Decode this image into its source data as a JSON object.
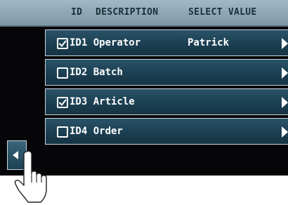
{
  "header": {
    "id_label": "ID",
    "description_label": "DESCRIPTION",
    "select_value_label": "SELECT VALUE"
  },
  "rows": [
    {
      "id": "ID1",
      "label": "ID1 Operator",
      "value": "Patrick",
      "checked": true
    },
    {
      "id": "ID2",
      "label": "ID2 Batch",
      "value": "",
      "checked": false
    },
    {
      "id": "ID3",
      "label": "ID3 Article",
      "value": "",
      "checked": true
    },
    {
      "id": "ID4",
      "label": "ID4 Order",
      "value": "",
      "checked": false
    }
  ],
  "icons": {
    "checkbox": "checkbox-icon",
    "row_arrow": "chevron-right-icon",
    "back": "arrow-left-icon",
    "hand": "hand-pointer-icon"
  },
  "colors": {
    "header_bg": "#9fb9c7",
    "row_bg": "#1c3f52",
    "screen_bg": "#060608"
  }
}
